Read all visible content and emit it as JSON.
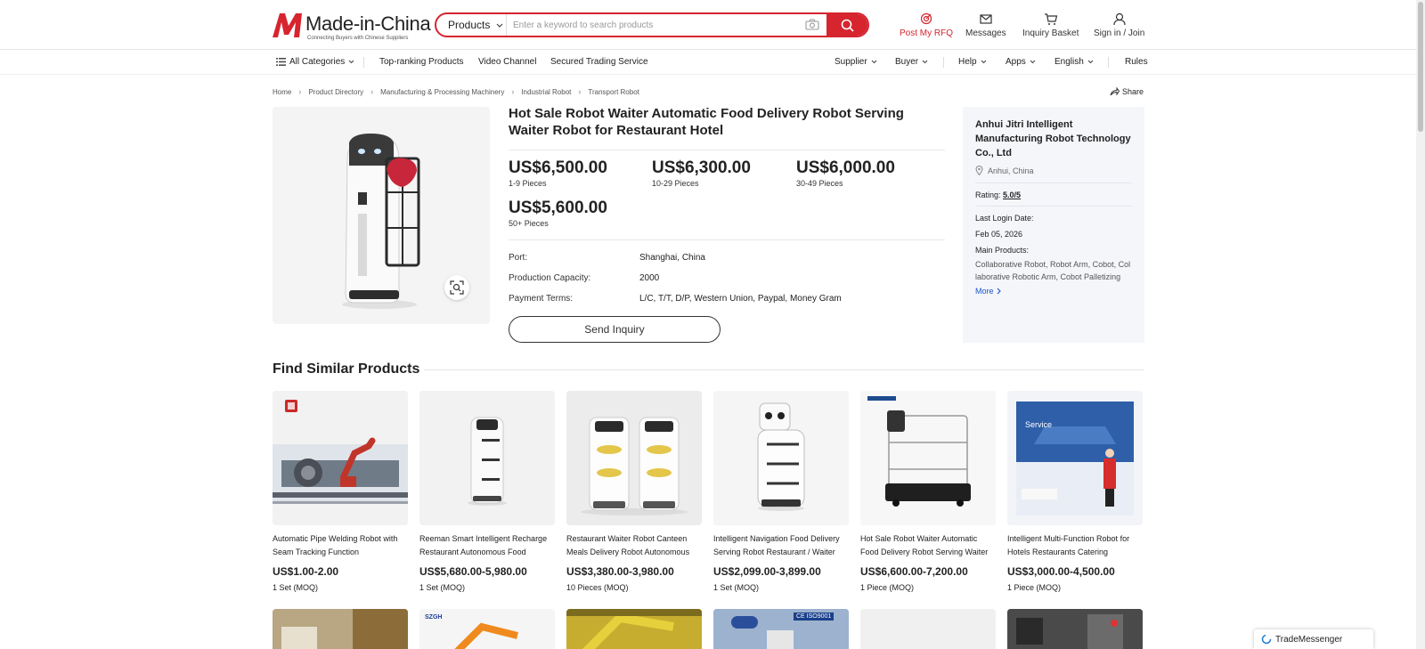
{
  "header": {
    "logo_title": "Made-in-China",
    "logo_tagline": "Connecting Buyers with Chinese Suppliers",
    "search": {
      "category": "Products",
      "placeholder": "Enter a keyword to search products"
    },
    "links": {
      "post_rfq": "Post My RFQ",
      "messages": "Messages",
      "inquiry_basket": "Inquiry Basket",
      "sign_in": "Sign in / Join"
    },
    "accent_color": "#d6252f"
  },
  "nav": {
    "all_categories": "All Categories",
    "top_ranking": "Top-ranking Products",
    "video_channel": "Video Channel",
    "secured_trading": "Secured Trading Service",
    "supplier": "Supplier",
    "buyer": "Buyer",
    "help": "Help",
    "apps": "Apps",
    "language": "English",
    "rules": "Rules"
  },
  "breadcrumb": [
    "Home",
    "Product Directory",
    "Manufacturing & Processing Machinery",
    "Industrial Robot",
    "Transport Robot"
  ],
  "share_label": "Share",
  "product": {
    "title": "Hot Sale Robot Waiter Automatic Food Delivery Robot Serving Waiter Robot for Restaurant Hotel",
    "prices": [
      {
        "price": "US$6,500.00",
        "qty": "1-9 Pieces"
      },
      {
        "price": "US$6,300.00",
        "qty": "10-29 Pieces"
      },
      {
        "price": "US$6,000.00",
        "qty": "30-49 Pieces"
      },
      {
        "price": "US$5,600.00",
        "qty": "50+ Pieces"
      }
    ],
    "specs": [
      {
        "label": "Port:",
        "value": "Shanghai, China"
      },
      {
        "label": "Production Capacity:",
        "value": "2000"
      },
      {
        "label": "Payment Terms:",
        "value": "L/C, T/T, D/P, Western Union, Paypal, Money Gram"
      }
    ],
    "send_inquiry": "Send Inquiry"
  },
  "supplier": {
    "name": "Anhui Jitri Intelligent Manufacturing Robot Technology Co., Ltd",
    "location": "Anhui, China",
    "rating_label": "Rating:",
    "rating_value": "5.0/5",
    "last_login_label": "Last Login Date:",
    "last_login_value": "Feb 05, 2026",
    "main_products_label": "Main Products:",
    "main_products_value": "Collaborative Robot, Robot Arm, Cobot, Collaborative Robotic Arm, Cobot Palletizing",
    "more_label": "More"
  },
  "similar": {
    "title": "Find Similar Products",
    "items": [
      {
        "name": "Automatic Pipe Welding Robot with Seam Tracking Function",
        "price": "US$1.00-2.00",
        "moq": "1 Set (MOQ)"
      },
      {
        "name": "Reeman Smart Intelligent Recharge Restaurant Autonomous Food Delivery Robot",
        "price": "US$5,680.00-5,980.00",
        "moq": "1 Set (MOQ)"
      },
      {
        "name": "Restaurant Waiter Robot Canteen Meals Delivery Robot Autonomous Serving Robot",
        "price": "US$3,380.00-3,980.00",
        "moq": "10 Pieces (MOQ)"
      },
      {
        "name": "Intelligent Navigation Food Delivery Serving Robot Restaurant / Waiter Robot",
        "price": "US$2,099.00-3,899.00",
        "moq": "1 Set (MOQ)"
      },
      {
        "name": "Hot Sale Robot Waiter Automatic Food Delivery Robot Serving Waiter Robot",
        "price": "US$6,600.00-7,200.00",
        "moq": "1 Piece (MOQ)"
      },
      {
        "name": "Intelligent Multi-Function Robot for Hotels Restaurants Catering Reception",
        "price": "US$3,000.00-4,500.00",
        "moq": "1 Piece (MOQ)"
      }
    ],
    "badge_service": "Service",
    "badge_ce": "CE ISO9001",
    "badge_szgh": "SZGH"
  },
  "trademessenger": "TradeMessenger"
}
